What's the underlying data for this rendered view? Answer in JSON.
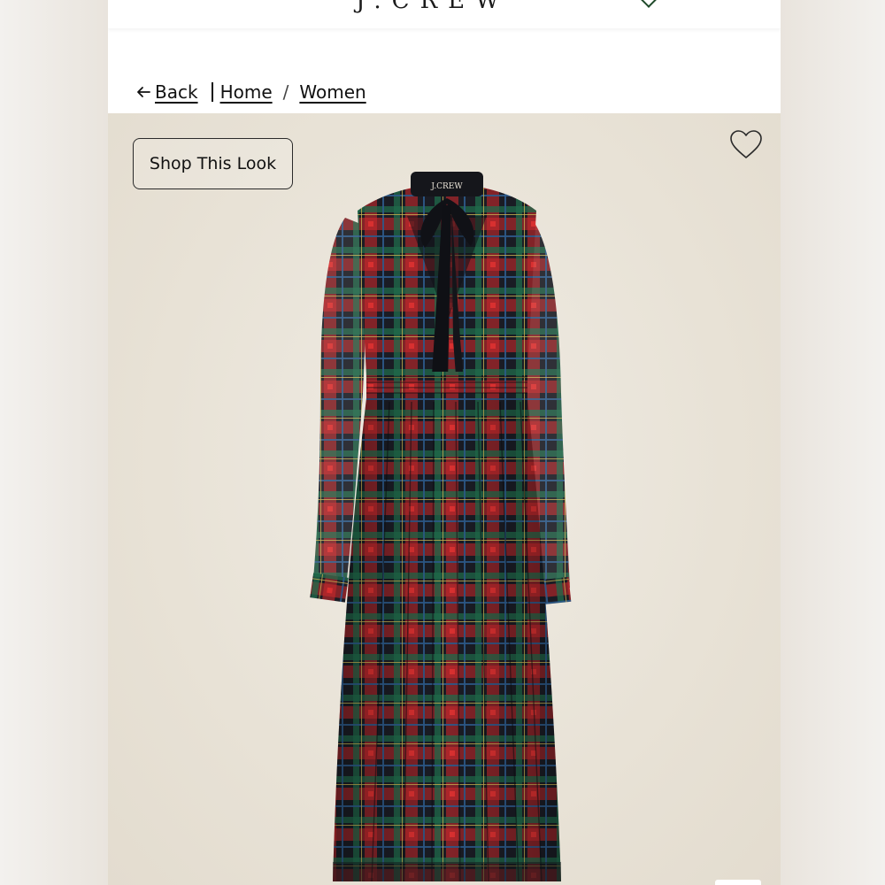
{
  "header": {
    "logo_fragment": "J.CREW"
  },
  "breadcrumb": {
    "back_label": "Back",
    "items": [
      "Home",
      "Women"
    ],
    "separator": "/"
  },
  "hero": {
    "shop_button_label": "Shop This Look",
    "brand_label": "J.CREW",
    "background_color": "#e8e2d6"
  },
  "colors": {
    "plaid_base": "#1a1c24",
    "plaid_red": "#c8282c",
    "plaid_green": "#1e6a4a",
    "plaid_blue": "#2c5a8a",
    "plaid_yellow": "#c8b050",
    "bag_green": "#1f4a2a"
  },
  "icons": [
    "arrow-left-icon",
    "heart-icon",
    "shopping-bag-icon"
  ]
}
